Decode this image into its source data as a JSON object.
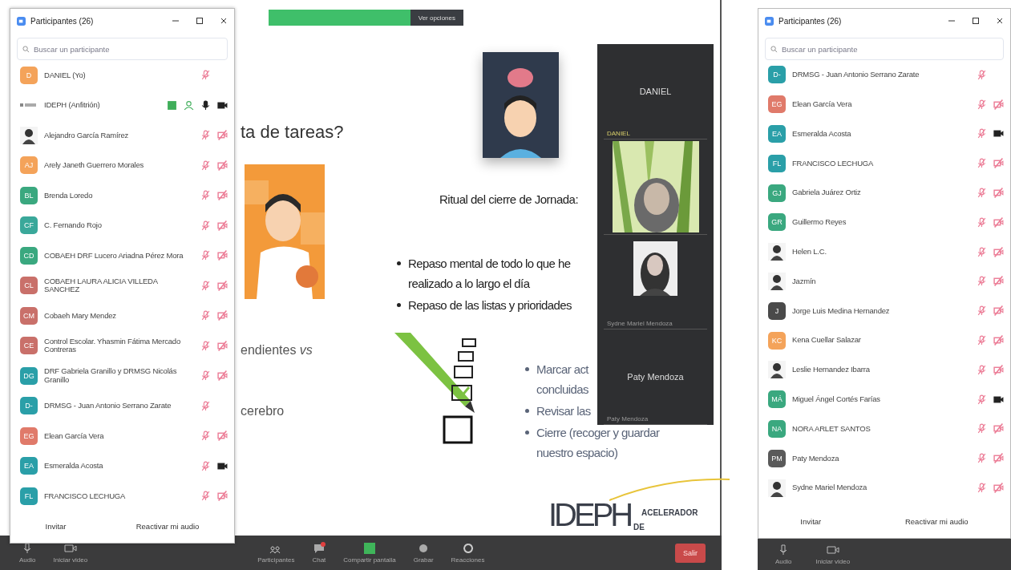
{
  "slide": {
    "title_fragment": "ta de tareas?",
    "fragments": [
      "endientes *vs*",
      "cerebro"
    ],
    "heading": "Ritual del cierre de Jornada:",
    "bullets_1": [
      "Repaso mental de todo lo que he\nrealizado a lo largo el día",
      "Repaso de las listas y prioridades"
    ],
    "bullets_2": [
      "Marcar act\nconcluidas",
      "Revisar las",
      "Cierre (recoger y guardar\nnuestro espacio)"
    ],
    "logo": {
      "main": "IDEPH",
      "line_1": "ACELERADOR",
      "line_2": "DE"
    }
  },
  "sharing_banner": {
    "button": "Ver opciones"
  },
  "video_strip": {
    "tiles": [
      {
        "kind": "name",
        "title": "DANIEL",
        "label": "DANIEL"
      },
      {
        "kind": "video"
      },
      {
        "kind": "video-small",
        "label": "Sydne Mariel Mendoza"
      },
      {
        "kind": "name",
        "title": "Paty Mendoza",
        "label": "Paty Mendoza"
      }
    ]
  },
  "toolbar": {
    "items": [
      {
        "kind": "audio",
        "label": "Audio"
      },
      {
        "kind": "video",
        "label": "Iniciar video"
      },
      {
        "kind": "participants",
        "label": "Participantes"
      },
      {
        "kind": "chat",
        "label": "Chat"
      },
      {
        "kind": "share",
        "label": "Compartir pantalla"
      },
      {
        "kind": "record",
        "label": "Grabar"
      },
      {
        "kind": "reactions",
        "label": "Reacciones"
      }
    ],
    "leave": "Salir"
  },
  "right_toolbar": {
    "items": [
      {
        "kind": "audio",
        "label": "Audio"
      },
      {
        "kind": "video",
        "label": "Iniciar video"
      }
    ]
  },
  "participant_windows": [
    {
      "title": "Participantes (26)",
      "search_placeholder": "Buscar un participante",
      "footer": [
        "Invitar",
        "Reactivar mi audio"
      ],
      "rows": [
        {
          "name": "DANIEL (Yo)",
          "kind": "initials",
          "initials": "D",
          "color": "#f4a35a",
          "muted": true,
          "camera": false
        },
        {
          "name": "IDEPH (Anfitrión)",
          "kind": "logo",
          "muted": false,
          "camera": true,
          "video_off": false
        },
        {
          "name": "Alejandro García Ramírez",
          "muted": true,
          "camera": true,
          "video_off": true
        },
        {
          "name": "Arely Janeth Guerrero Morales",
          "kind": "initials",
          "initials": "AJ",
          "color": "#f4a35a",
          "muted": true,
          "camera": true,
          "video_off": true
        },
        {
          "name": "Brenda Loredo",
          "kind": "initials",
          "initials": "BL",
          "color": "#3aa87f",
          "muted": true,
          "camera": true,
          "video_off": true
        },
        {
          "name": "C. Fernando Rojo",
          "kind": "initials",
          "initials": "CF",
          "color": "#3aa89a",
          "muted": true,
          "camera": true,
          "video_off": true
        },
        {
          "name": "COBAEH DRF Lucero Ariadna Pérez Mora",
          "kind": "initials",
          "initials": "CD",
          "color": "#3aa87f",
          "muted": true,
          "camera": true,
          "video_off": true
        },
        {
          "name": "COBAEH LAURA ALICIA VILLEDA SANCHEZ",
          "kind": "initials",
          "initials": "CL",
          "color": "#c9706a",
          "muted": true,
          "camera": true,
          "video_off": true
        },
        {
          "name": "Cobaeh Mary Mendez",
          "kind": "initials",
          "initials": "CM",
          "color": "#c9706a",
          "muted": true,
          "camera": true,
          "video_off": true
        },
        {
          "name": "Control Escolar. Yhasmin Fátima Mercado Contreras",
          "kind": "initials",
          "initials": "CE",
          "color": "#c9706a",
          "muted": true,
          "camera": true,
          "video_off": true
        },
        {
          "name": "DRF Gabriela Granillo y DRMSG Nicolás Granillo",
          "kind": "initials",
          "initials": "DG",
          "color": "#2a9fa8",
          "muted": true,
          "camera": true,
          "video_off": true
        },
        {
          "name": "DRMSG - Juan Antonio Serrano Zarate",
          "kind": "initials",
          "initials": "D-",
          "color": "#2a9fa8",
          "muted": true,
          "camera": false
        },
        {
          "name": "Elean García Vera",
          "kind": "initials",
          "initials": "EG",
          "color": "#e07a6a",
          "muted": true,
          "camera": true,
          "video_off": true
        },
        {
          "name": "Esmeralda Acosta",
          "kind": "initials",
          "initials": "EA",
          "color": "#2a9fa8",
          "muted": true,
          "camera": true,
          "video_off": false
        },
        {
          "name": "FRANCISCO LECHUGA",
          "kind": "initials",
          "initials": "FL",
          "color": "#2a9fa8",
          "muted": true,
          "camera": true,
          "video_off": true
        }
      ]
    },
    {
      "title": "Participantes (26)",
      "search_placeholder": "Buscar un participante",
      "footer": [
        "Invitar",
        "Reactivar mi audio"
      ],
      "rows": [
        {
          "name": "DRMSG - Juan Antonio Serrano Zarate",
          "kind": "initials",
          "initials": "D-",
          "color": "#2a9fa8",
          "muted": true,
          "camera": false
        },
        {
          "name": "Elean García Vera",
          "kind": "initials",
          "initials": "EG",
          "color": "#e07a6a",
          "muted": true,
          "camera": true,
          "video_off": true
        },
        {
          "name": "Esmeralda Acosta",
          "kind": "initials",
          "initials": "EA",
          "color": "#2a9fa8",
          "muted": true,
          "camera": true,
          "video_off": false
        },
        {
          "name": "FRANCISCO LECHUGA",
          "kind": "initials",
          "initials": "FL",
          "color": "#2a9fa8",
          "muted": true,
          "camera": true,
          "video_off": true
        },
        {
          "name": "Gabriela Juárez Ortiz",
          "kind": "initials",
          "initials": "GJ",
          "color": "#3aa87f",
          "muted": true,
          "camera": true,
          "video_off": true
        },
        {
          "name": "Guillermo Reyes",
          "kind": "initials",
          "initials": "GR",
          "color": "#3aa87f",
          "muted": true,
          "camera": true,
          "video_off": true
        },
        {
          "name": "Helen L.C.",
          "muted": true,
          "camera": true,
          "video_off": true
        },
        {
          "name": "Jazmín",
          "muted": true,
          "camera": true,
          "video_off": true
        },
        {
          "name": "Jorge Luis Medina Hernandez",
          "kind": "initials",
          "initials": "J",
          "color": "#4a4a4a",
          "muted": true,
          "camera": true,
          "video_off": true
        },
        {
          "name": "Kena Cuellar Salazar",
          "kind": "initials",
          "initials": "KC",
          "color": "#f4a35a",
          "muted": true,
          "camera": true,
          "video_off": true
        },
        {
          "name": "Leslie Hernandez Ibarra",
          "muted": true,
          "camera": true,
          "video_off": true
        },
        {
          "name": "Miguel Ángel Cortés Farías",
          "kind": "initials",
          "initials": "MÁ",
          "color": "#3aa87f",
          "muted": true,
          "camera": true,
          "video_off": false
        },
        {
          "name": "NORA ARLET SANTOS",
          "kind": "initials",
          "initials": "NA",
          "color": "#3aa87f",
          "muted": true,
          "camera": true,
          "video_off": true
        },
        {
          "name": "Paty Mendoza",
          "kind": "initials",
          "initials": "PM",
          "color": "#5a5a5a",
          "muted": true,
          "camera": true,
          "video_off": true
        },
        {
          "name": "Sydne Mariel Mendoza",
          "muted": true,
          "camera": true,
          "video_off": true
        }
      ]
    }
  ]
}
